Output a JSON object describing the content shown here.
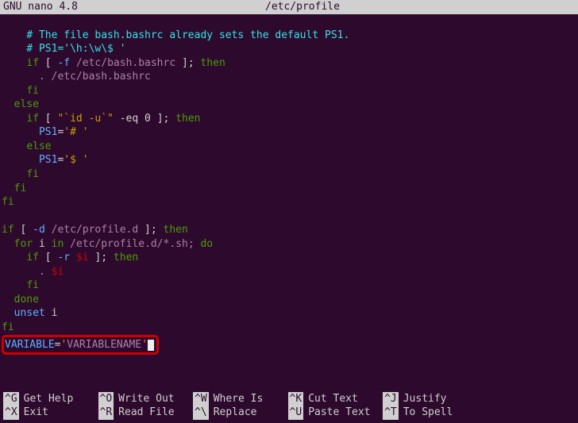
{
  "header": {
    "app": "GNU nano 4.8",
    "file": "/etc/profile"
  },
  "code": {
    "l1_comment": "# The file bash.bashrc already sets the default PS1.",
    "l2_comment": "# PS1='\\h:\\w\\$ '",
    "l3_if": "if",
    "l3_br": " [ ",
    "l3_flag": "-f",
    "l3_path": " /etc/bash.bashrc",
    "l3_br2": " ]; ",
    "l3_then": "then",
    "l4_src": ". /etc/bash.bashrc",
    "l5_fi": "fi",
    "l6_else": "else",
    "l7_if": "if",
    "l7_br": " [ ",
    "l7_q1": "\"",
    "l7_cmd": "`id -u`",
    "l7_q2": "\"",
    "l7_eq": " -eq ",
    "l7_zero": "0",
    "l7_br2": " ]; ",
    "l7_then": "then",
    "l8_var": "PS1",
    "l8_eq": "=",
    "l8_val": "'# '",
    "l9_else": "else",
    "l10_var": "PS1",
    "l10_eq": "=",
    "l10_val": "'$ '",
    "l11_fi": "fi",
    "l12_fi": "fi",
    "l13_fi": "fi",
    "l15_if": "if",
    "l15_br": " [ ",
    "l15_flag": "-d",
    "l15_path": " /etc/profile.d",
    "l15_br2": " ]; ",
    "l15_then": "then",
    "l16_for": "for",
    "l16_i": " i ",
    "l16_in": "in",
    "l16_glob": " /etc/profile.d/*.sh; ",
    "l16_do": "do",
    "l17_if": "if",
    "l17_br": " [ ",
    "l17_flag": "-r",
    "l17_sp": " ",
    "l17_var": "$i",
    "l17_br2": " ]; ",
    "l17_then": "then",
    "l18_dot": ". ",
    "l18_var": "$i",
    "l19_fi": "fi",
    "l20_done": "done",
    "l21_unset": "unset",
    "l21_i": " i",
    "l22_fi": "fi",
    "l23_var": "VARIABLE",
    "l23_eq": "=",
    "l23_q": "'",
    "l23_val": "VARIABLENAME",
    "l23_q2": "'"
  },
  "footer": {
    "r1": [
      {
        "key": "^G",
        "label": "Get Help"
      },
      {
        "key": "^O",
        "label": "Write Out"
      },
      {
        "key": "^W",
        "label": "Where Is"
      },
      {
        "key": "^K",
        "label": "Cut Text"
      },
      {
        "key": "^J",
        "label": "Justify"
      }
    ],
    "r2": [
      {
        "key": "^X",
        "label": "Exit"
      },
      {
        "key": "^R",
        "label": "Read File"
      },
      {
        "key": "^\\",
        "label": "Replace"
      },
      {
        "key": "^U",
        "label": "Paste Text"
      },
      {
        "key": "^T",
        "label": "To Spell"
      }
    ]
  }
}
